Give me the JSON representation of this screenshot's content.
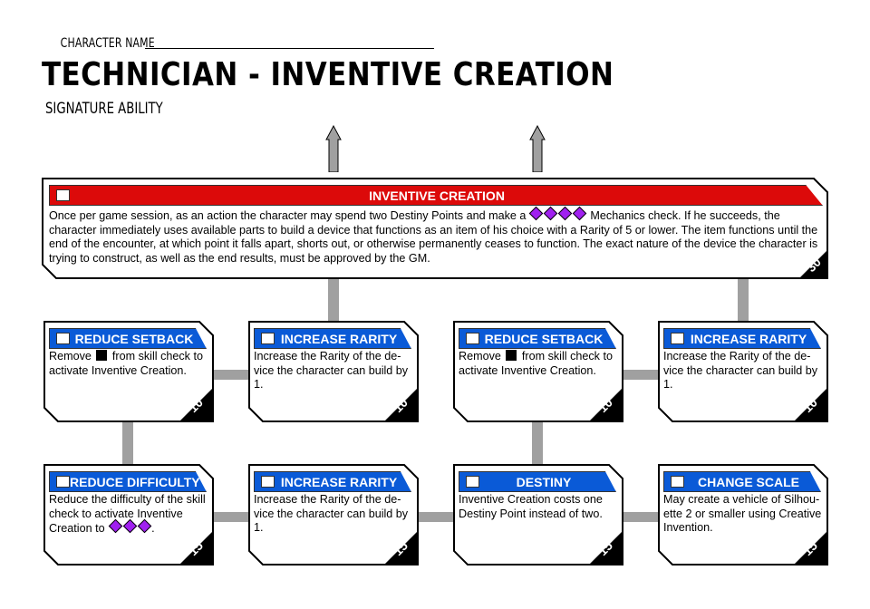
{
  "header": {
    "character_name_label": "CHARACTER NAME",
    "character_name_value": "",
    "title": "TECHNICIAN - INVENTIVE CREATION",
    "subtitle": "SIGNATURE ABILITY"
  },
  "colors": {
    "main_header": "#dc0a0a",
    "upgrade_header": "#0a5ad7",
    "connector": "#a0a0a0",
    "difficulty_die": "#a020f0",
    "setback_die": "#000000"
  },
  "main_ability": {
    "name": "INVENTIVE CREATION",
    "text_before_dice": "Once per game session, as an action the character may spend two Destiny Points and make a",
    "difficulty_dice": 4,
    "text_after_dice": "Mechanics check. If he succeeds, the character immediately uses available parts to build a device that functions as an item of his choice with a Rarity of 5 or lower. The item functions until the end of the encounter, at which point it falls apart, shorts out, or otherwise permanently ceases to function. The exact nature of the device the character is trying to construct, as well as the end results, must be approved by the GM.",
    "cost": "30",
    "checked": false
  },
  "upgrades": [
    {
      "name": "REDUCE SETBACK",
      "text_before": "Remove",
      "icon": "setback-die",
      "text_after": "from skill check to activate Inventive Creation.",
      "cost": "10",
      "checked": false
    },
    {
      "name": "INCREASE RARITY",
      "text_before": "Increase the Rarity of the de-vice the character can build by 1.",
      "icon": "",
      "text_after": "",
      "cost": "10",
      "checked": false
    },
    {
      "name": "REDUCE SETBACK",
      "text_before": "Remove",
      "icon": "setback-die",
      "text_after": "from skill check to activate Inventive Creation.",
      "cost": "10",
      "checked": false
    },
    {
      "name": "INCREASE RARITY",
      "text_before": "Increase the Rarity of the de-vice the character can build by 1.",
      "icon": "",
      "text_after": "",
      "cost": "10",
      "checked": false
    },
    {
      "name": "REDUCE DIFFICULTY",
      "text_before": "Reduce the difficulty of the skill check to activate Inventive Creation to",
      "icon": "difficulty-dice-3",
      "text_after": ".",
      "cost": "15",
      "checked": false
    },
    {
      "name": "INCREASE RARITY",
      "text_before": "Increase the Rarity of the de-vice the character can build by 1.",
      "icon": "",
      "text_after": "",
      "cost": "15",
      "checked": false
    },
    {
      "name": "DESTINY",
      "text_before": "Inventive Creation costs one Destiny Point instead of two.",
      "icon": "",
      "text_after": "",
      "cost": "15",
      "checked": false
    },
    {
      "name": "CHANGE SCALE",
      "text_before": "May create a vehicle of Silhou-ette 2 or smaller using Creative Invention.",
      "icon": "",
      "text_after": "",
      "cost": "15",
      "checked": false
    }
  ]
}
